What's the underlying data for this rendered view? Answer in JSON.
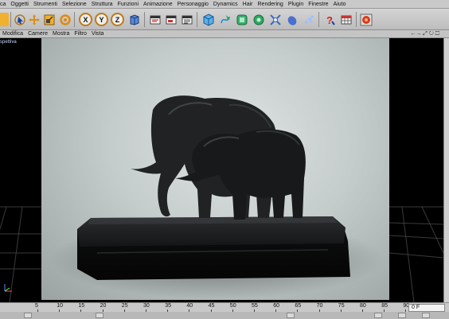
{
  "menubar": {
    "items": [
      "ca",
      "Oggetti",
      "Strumenti",
      "Selezione",
      "Struttura",
      "Funzioni",
      "Animazione",
      "Personaggio",
      "Dynamics",
      "Hair",
      "Rendering",
      "Plugin",
      "Finestre",
      "Aiuto"
    ]
  },
  "toolbar": {
    "axis_x": "X",
    "axis_y": "Y",
    "axis_z": "Z"
  },
  "viewbar": {
    "items": [
      "Modifica",
      "Camere",
      "Mostra",
      "Filtro",
      "Vista"
    ],
    "nav_icons": "←→ ⤢ ↻ ☐"
  },
  "viewport": {
    "label": "spettiva"
  },
  "timeline": {
    "ticks": [
      "5",
      "10",
      "15",
      "20",
      "25",
      "30",
      "35",
      "40",
      "45",
      "50",
      "55",
      "60",
      "65",
      "70",
      "75",
      "80",
      "85",
      "90"
    ],
    "frame_value": "0 F"
  },
  "colors": {
    "ui_gray": "#c9c9c9",
    "viewport_bg": "#000000",
    "axis_ring": "#c07a1a",
    "sculpture": "#1e1f21"
  }
}
